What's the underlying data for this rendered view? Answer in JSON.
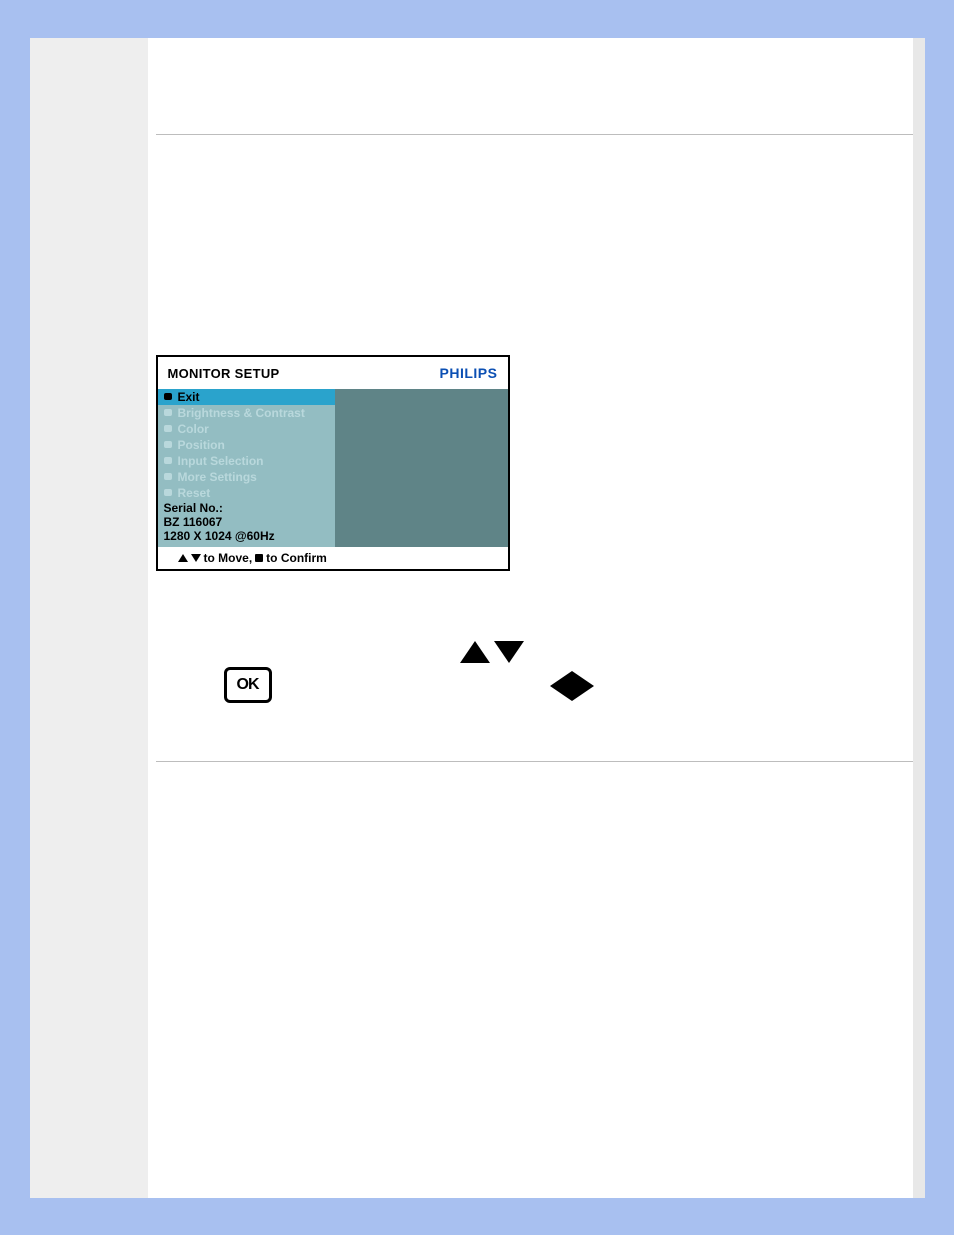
{
  "osd": {
    "title": "MONITOR SETUP",
    "brand": "PHILIPS",
    "items": [
      "Exit",
      "Brightness & Contrast",
      "Color",
      "Position",
      "Input Selection",
      "More Settings",
      "Reset"
    ],
    "selected_index": 0,
    "serial_label": "Serial No.:",
    "serial_value": "BZ 116067",
    "resolution": "1280 X 1024 @60Hz",
    "footer_move": " to Move, ",
    "footer_confirm": " to Confirm"
  },
  "controls": {
    "ok_label": "OK"
  }
}
